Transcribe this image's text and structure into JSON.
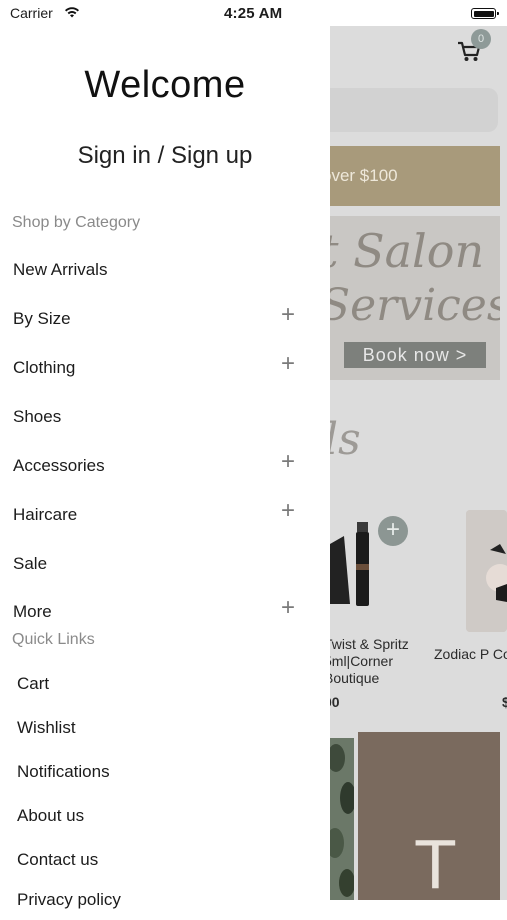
{
  "status_bar": {
    "carrier": "Carrier",
    "time": "4:25 AM"
  },
  "background_app": {
    "cart_count": "0",
    "promo_text": "over $100",
    "salon_banner": {
      "line1": "t Salon",
      "line2": "Services",
      "button": "Book now >"
    },
    "section_script": "ls",
    "product1": {
      "name": "Twist & Spritz 5ml|Corner Boutique",
      "price": "00"
    },
    "product2": {
      "name": "Zodiac P Corner Sto",
      "price": "$"
    },
    "bottom_banner_letter": "T"
  },
  "drawer": {
    "welcome": "Welcome",
    "signin": "Sign in / Sign up",
    "category_title": "Shop by Category",
    "categories": [
      {
        "label": "New Arrivals",
        "expandable": false
      },
      {
        "label": "By Size",
        "expandable": true
      },
      {
        "label": "Clothing",
        "expandable": true
      },
      {
        "label": "Shoes",
        "expandable": false
      },
      {
        "label": "Accessories",
        "expandable": true
      },
      {
        "label": "Haircare",
        "expandable": true
      },
      {
        "label": "Sale",
        "expandable": false
      },
      {
        "label": "More",
        "expandable": true
      }
    ],
    "quick_links_title": "Quick Links",
    "quick_links": [
      {
        "label": "Cart"
      },
      {
        "label": "Wishlist"
      },
      {
        "label": "Notifications"
      },
      {
        "label": "About us"
      },
      {
        "label": "Contact us"
      },
      {
        "label": "Privacy policy"
      }
    ],
    "expand_symbol": "+"
  },
  "colors": {
    "accent_gold": "#a89a7b",
    "badge_gray": "#8e9a98",
    "muted_text": "#8a8a8a"
  }
}
